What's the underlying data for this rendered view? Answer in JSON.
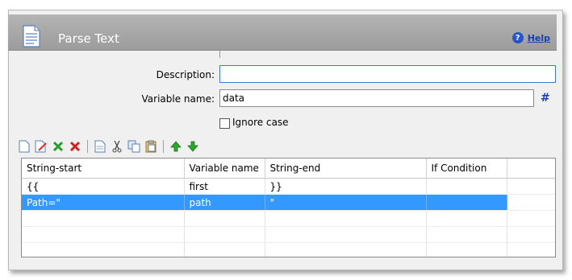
{
  "title": "Parse Text",
  "help_label": "Help",
  "form": {
    "description_label": "Description:",
    "description_value": "",
    "variable_name_label": "Variable name:",
    "variable_name_value": "data",
    "hash_label": "#",
    "ignore_case_label": "Ignore case",
    "ignore_case_checked": false
  },
  "toolbar": {
    "icons": [
      "new-row-icon",
      "edit-row-icon",
      "delete-green-icon",
      "delete-red-icon",
      "copy-icon",
      "cut-icon",
      "duplicate-icon",
      "paste-icon",
      "move-up-icon",
      "move-down-icon"
    ]
  },
  "grid": {
    "columns": [
      "String-start",
      "Variable name",
      "String-end",
      "If Condition"
    ],
    "rows": [
      [
        "{{",
        "first",
        "}}",
        ""
      ],
      [
        "Path=\"",
        "path",
        "\"",
        ""
      ]
    ],
    "selected_row": 1
  },
  "colors": {
    "titlebar": "#a8a8a8",
    "selection": "#3399ff",
    "link": "#1a3fb0"
  }
}
